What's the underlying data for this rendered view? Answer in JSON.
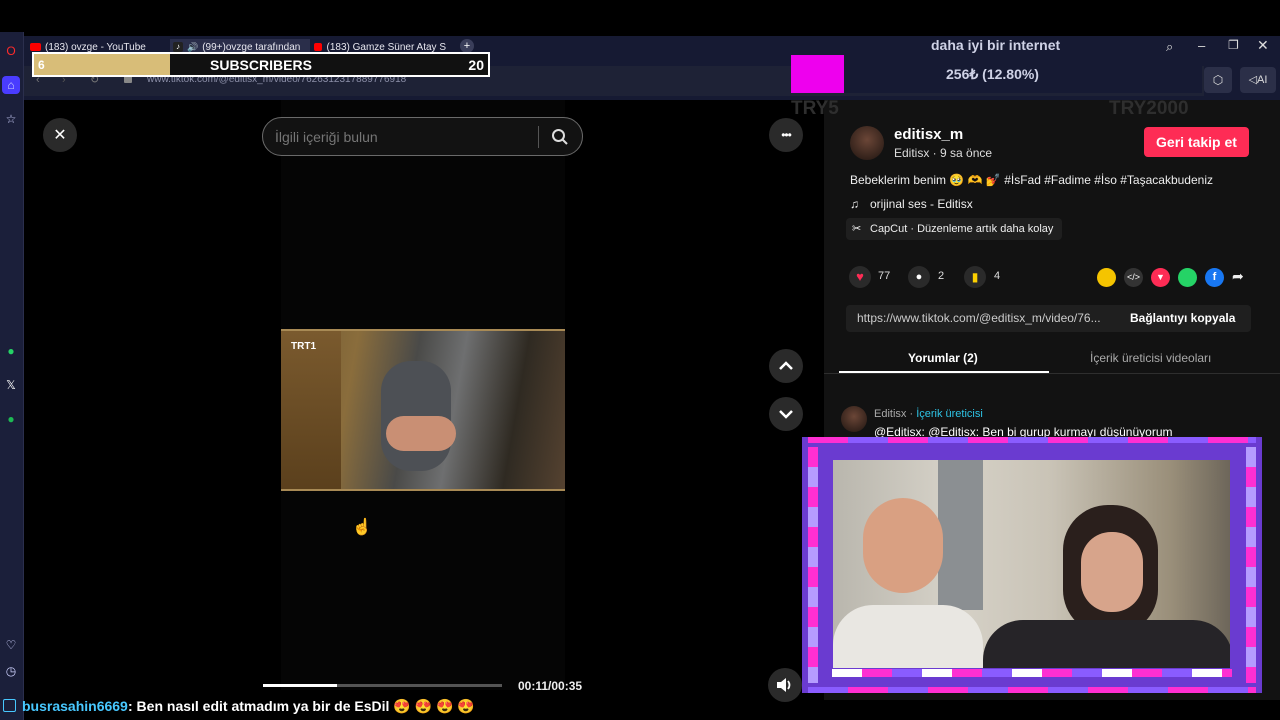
{
  "browser": {
    "tabs": [
      {
        "label": "(183) ovzge - YouTube",
        "kind": "youtube"
      },
      {
        "label": "(99+)ovzge tarafından",
        "kind": "tiktok"
      },
      {
        "label": "(183) Gamze Süner Atay S",
        "kind": "youtube"
      }
    ],
    "new_tab": "+",
    "url": "www.tiktok.com/@editisx_m/video/7626312317889776918",
    "ai_label": "AI"
  },
  "stream_overlay": {
    "sub_current": "6",
    "sub_label": "SUBSCRIBERS",
    "sub_goal": "20",
    "sub_progress": 0.3,
    "donation_title": "daha iyi bir internet",
    "donation_amount": "256₺ (12.80%)",
    "donation_min": "TRY5",
    "donation_max": "TRY2000",
    "donation_progress": 0.128,
    "chat_user": "busrasahin6669",
    "chat_message": ": Ben nasıl edit atmadım ya bir de EsDil",
    "chat_emojis": "😍 😍 😍 😍"
  },
  "tiktok": {
    "search_placeholder": "İlgili içeriği bulun",
    "channel_tag": "TRT1",
    "time": "00:11/00:35",
    "video_progress": 0.31,
    "author": {
      "username": "editisx_m",
      "display": "Editisx · 9 sa önce",
      "follow_button": "Geri takip et"
    },
    "caption": "Bebeklerim benim 🥹 🫶 💅 #İsFad #Fadime #İso #Taşacakbudeniz",
    "sound": "orijinal ses - Editisx",
    "capcut": "CapCut · Düzenleme artık daha kolay",
    "likes": "77",
    "comments": "2",
    "saves": "4",
    "link": "https://www.tiktok.com/@editisx_m/video/76...",
    "copy_link": "Bağlantıyı kopyala",
    "tab_comments": "Yorumlar (2)",
    "tab_creator": "İçerik üreticisi videoları",
    "comment_author": "Editisx",
    "comment_badge": "İçerik üreticisi",
    "comment_text": "@Editisx: @Editisx: Ben bi gurup kurmayı düşünüyorum",
    "colors": {
      "accent": "#fe2c55",
      "sub_fill": "#d8bd78",
      "donation_fill": "#ee00ee",
      "cam_frame": "#6a3bd0"
    }
  },
  "icons": {
    "close": "✕",
    "search": "search-icon",
    "more": "•••",
    "up": "chevron-up-icon",
    "down": "chevron-down-icon",
    "volume": "volume-icon",
    "note": "♫"
  }
}
